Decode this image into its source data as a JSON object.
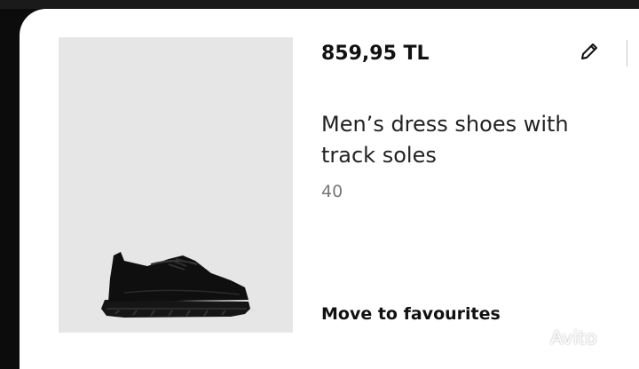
{
  "product": {
    "price": "859,95 TL",
    "title": "Men’s dress shoes with track soles",
    "size": "40",
    "image_icon": "shoe-photo"
  },
  "actions": {
    "edit_icon": "pencil-icon",
    "move_to_favourites": "Move to favourites"
  },
  "watermark": {
    "text": "Avito"
  },
  "colors": {
    "card_background": "#ffffff",
    "image_background": "#e6e6e6",
    "screen_background": "#0c0c0c",
    "text_primary": "#111111",
    "text_secondary": "#777777"
  }
}
